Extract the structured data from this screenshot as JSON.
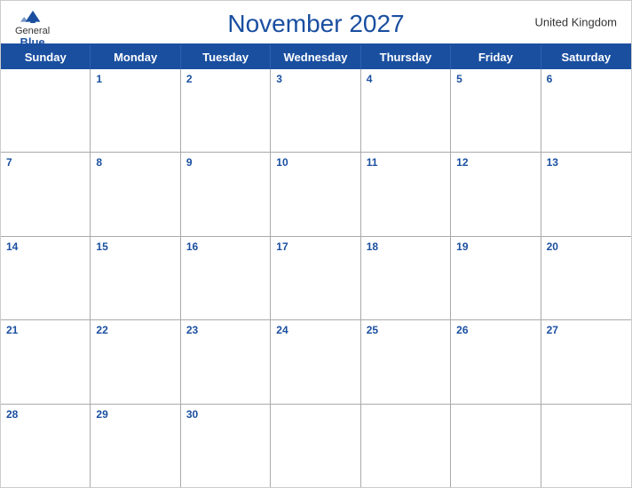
{
  "header": {
    "title": "November 2027",
    "country": "United Kingdom",
    "logo": {
      "general": "General",
      "blue": "Blue"
    }
  },
  "days_of_week": [
    "Sunday",
    "Monday",
    "Tuesday",
    "Wednesday",
    "Thursday",
    "Friday",
    "Saturday"
  ],
  "weeks": [
    [
      {
        "date": "",
        "type": "empty"
      },
      {
        "date": "1",
        "type": "normal"
      },
      {
        "date": "2",
        "type": "normal"
      },
      {
        "date": "3",
        "type": "normal"
      },
      {
        "date": "4",
        "type": "normal"
      },
      {
        "date": "5",
        "type": "normal"
      },
      {
        "date": "6",
        "type": "normal"
      }
    ],
    [
      {
        "date": "7",
        "type": "normal"
      },
      {
        "date": "8",
        "type": "normal"
      },
      {
        "date": "9",
        "type": "normal"
      },
      {
        "date": "10",
        "type": "normal"
      },
      {
        "date": "11",
        "type": "normal"
      },
      {
        "date": "12",
        "type": "normal"
      },
      {
        "date": "13",
        "type": "normal"
      }
    ],
    [
      {
        "date": "14",
        "type": "normal"
      },
      {
        "date": "15",
        "type": "normal"
      },
      {
        "date": "16",
        "type": "normal"
      },
      {
        "date": "17",
        "type": "normal"
      },
      {
        "date": "18",
        "type": "normal"
      },
      {
        "date": "19",
        "type": "normal"
      },
      {
        "date": "20",
        "type": "normal"
      }
    ],
    [
      {
        "date": "21",
        "type": "normal"
      },
      {
        "date": "22",
        "type": "normal"
      },
      {
        "date": "23",
        "type": "normal"
      },
      {
        "date": "24",
        "type": "normal"
      },
      {
        "date": "25",
        "type": "normal"
      },
      {
        "date": "26",
        "type": "normal"
      },
      {
        "date": "27",
        "type": "normal"
      }
    ],
    [
      {
        "date": "28",
        "type": "normal"
      },
      {
        "date": "29",
        "type": "normal"
      },
      {
        "date": "30",
        "type": "normal"
      },
      {
        "date": "",
        "type": "empty"
      },
      {
        "date": "",
        "type": "empty"
      },
      {
        "date": "",
        "type": "empty"
      },
      {
        "date": "",
        "type": "empty"
      }
    ]
  ],
  "colors": {
    "primary_blue": "#1a4fa0",
    "header_bg": "#1a4fa0",
    "border": "#aaa"
  }
}
